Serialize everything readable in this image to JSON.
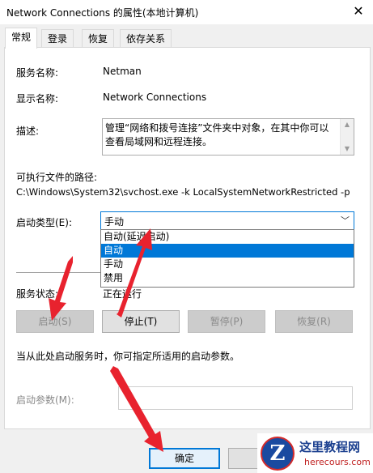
{
  "window": {
    "title": "Network Connections 的属性(本地计算机)",
    "close_glyph": "✕"
  },
  "tabs": [
    {
      "label": "常规",
      "active": true
    },
    {
      "label": "登录",
      "active": false
    },
    {
      "label": "恢复",
      "active": false
    },
    {
      "label": "依存关系",
      "active": false
    }
  ],
  "general": {
    "service_name_label": "服务名称:",
    "service_name": "Netman",
    "display_name_label": "显示名称:",
    "display_name": "Network Connections",
    "description_label": "描述:",
    "description": "管理“网络和拨号连接”文件夹中对象，在其中你可以查看局域网和远程连接。",
    "path_label": "可执行文件的路径:",
    "path": "C:\\Windows\\System32\\svchost.exe -k LocalSystemNetworkRestricted -p",
    "startup_type_label": "启动类型(E):",
    "startup_type_value": "手动",
    "startup_options": [
      "自动(延迟启动)",
      "自动",
      "手动",
      "禁用"
    ],
    "startup_selected_index": 1,
    "status_label": "服务状态:",
    "status_value": "正在运行",
    "buttons": {
      "start": "启动(S)",
      "stop": "停止(T)",
      "pause": "暂停(P)",
      "resume": "恢复(R)"
    },
    "hint": "当从此处启动服务时，你可指定所适用的启动参数。",
    "start_params_label": "启动参数(M):",
    "start_params_value": ""
  },
  "footer": {
    "ok_label": "确定"
  },
  "watermark": {
    "logo_letter": "Z",
    "site_name": "这里教程网",
    "url": "herecours.com"
  },
  "colors": {
    "accent": "#0078d7",
    "arrow": "#e8222e",
    "panel": "#ffffff",
    "chrome": "#f0f0f0"
  }
}
